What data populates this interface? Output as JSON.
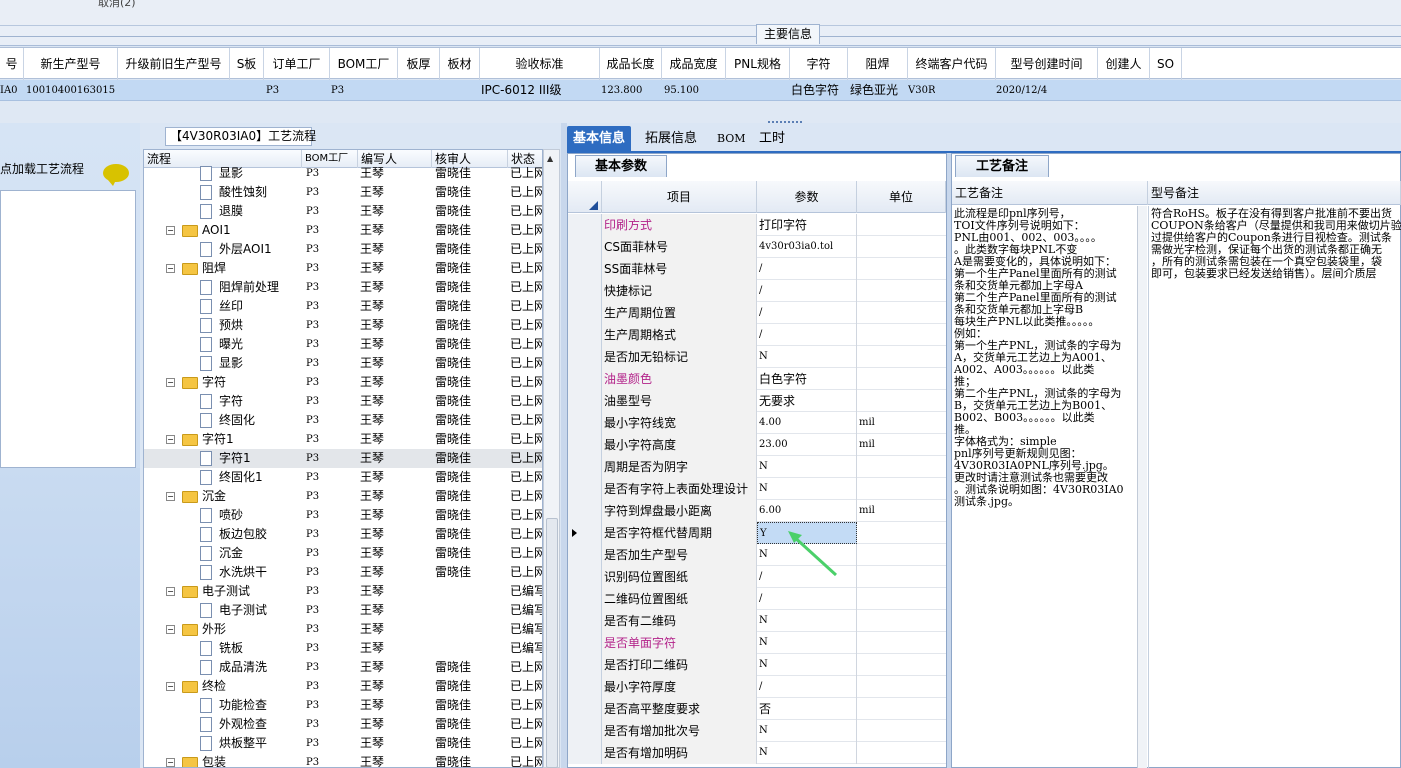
{
  "top": {
    "cancel_text": "取消(2)"
  },
  "main_info": {
    "title": "主要信息",
    "columns": [
      "号",
      "新生产型号",
      "升级前旧生产型号",
      "S板",
      "订单工厂",
      "BOM工厂",
      "板厚",
      "板材",
      "验收标准",
      "成品长度",
      "成品宽度",
      "PNL规格",
      "字符",
      "阻焊",
      "终端客户代码",
      "型号创建时间",
      "创建人",
      "SO"
    ],
    "row": {
      "c0": "IA0",
      "c1": "10010400163015",
      "c4": "P3",
      "c5": "P3",
      "c8": "IPC-6012 III级",
      "c9": "123.800",
      "c10": "95.100",
      "c12": "白色字符",
      "c13": "绿色亚光",
      "c14": "V30R",
      "c15": "2020/12/4"
    }
  },
  "left_panel": {
    "load_text": "点加载工艺流程"
  },
  "flow": {
    "title": "【4V30R03IA0】工艺流程",
    "headers": [
      "流程",
      "BOM工厂",
      "编写人",
      "核审人",
      "状态"
    ],
    "rows": [
      {
        "level": 2,
        "type": "doc",
        "name": "显影",
        "bom": "P3",
        "writer": "王琴",
        "reviewer": "雷晓佳",
        "status": "已上网"
      },
      {
        "level": 2,
        "type": "doc",
        "name": "酸性蚀刻",
        "bom": "P3",
        "writer": "王琴",
        "reviewer": "雷晓佳",
        "status": "已上网"
      },
      {
        "level": 2,
        "type": "doc",
        "name": "退膜",
        "bom": "P3",
        "writer": "王琴",
        "reviewer": "雷晓佳",
        "status": "已上网"
      },
      {
        "level": 1,
        "type": "folder",
        "name": "AOI1",
        "bom": "P3",
        "writer": "王琴",
        "reviewer": "雷晓佳",
        "status": "已上网"
      },
      {
        "level": 2,
        "type": "doc",
        "name": "外层AOI1",
        "bom": "P3",
        "writer": "王琴",
        "reviewer": "雷晓佳",
        "status": "已上网"
      },
      {
        "level": 1,
        "type": "folder",
        "name": "阻焊",
        "bom": "P3",
        "writer": "王琴",
        "reviewer": "雷晓佳",
        "status": "已上网"
      },
      {
        "level": 2,
        "type": "doc",
        "name": "阻焊前处理",
        "bom": "P3",
        "writer": "王琴",
        "reviewer": "雷晓佳",
        "status": "已上网"
      },
      {
        "level": 2,
        "type": "doc",
        "name": "丝印",
        "bom": "P3",
        "writer": "王琴",
        "reviewer": "雷晓佳",
        "status": "已上网"
      },
      {
        "level": 2,
        "type": "doc",
        "name": "预烘",
        "bom": "P3",
        "writer": "王琴",
        "reviewer": "雷晓佳",
        "status": "已上网"
      },
      {
        "level": 2,
        "type": "doc",
        "name": "曝光",
        "bom": "P3",
        "writer": "王琴",
        "reviewer": "雷晓佳",
        "status": "已上网"
      },
      {
        "level": 2,
        "type": "doc",
        "name": "显影",
        "bom": "P3",
        "writer": "王琴",
        "reviewer": "雷晓佳",
        "status": "已上网"
      },
      {
        "level": 1,
        "type": "folder",
        "name": "字符",
        "bom": "P3",
        "writer": "王琴",
        "reviewer": "雷晓佳",
        "status": "已上网"
      },
      {
        "level": 2,
        "type": "doc",
        "name": "字符",
        "bom": "P3",
        "writer": "王琴",
        "reviewer": "雷晓佳",
        "status": "已上网"
      },
      {
        "level": 2,
        "type": "doc",
        "name": "终固化",
        "bom": "P3",
        "writer": "王琴",
        "reviewer": "雷晓佳",
        "status": "已上网"
      },
      {
        "level": 1,
        "type": "folder",
        "name": "字符1",
        "bom": "P3",
        "writer": "王琴",
        "reviewer": "雷晓佳",
        "status": "已上网"
      },
      {
        "level": 2,
        "type": "doc",
        "name": "字符1",
        "bom": "P3",
        "writer": "王琴",
        "reviewer": "雷晓佳",
        "status": "已上网",
        "selected": true
      },
      {
        "level": 2,
        "type": "doc",
        "name": "终固化1",
        "bom": "P3",
        "writer": "王琴",
        "reviewer": "雷晓佳",
        "status": "已上网"
      },
      {
        "level": 1,
        "type": "folder",
        "name": "沉金",
        "bom": "P3",
        "writer": "王琴",
        "reviewer": "雷晓佳",
        "status": "已上网"
      },
      {
        "level": 2,
        "type": "doc",
        "name": "喷砂",
        "bom": "P3",
        "writer": "王琴",
        "reviewer": "雷晓佳",
        "status": "已上网"
      },
      {
        "level": 2,
        "type": "doc",
        "name": "板边包胶",
        "bom": "P3",
        "writer": "王琴",
        "reviewer": "雷晓佳",
        "status": "已上网"
      },
      {
        "level": 2,
        "type": "doc",
        "name": "沉金",
        "bom": "P3",
        "writer": "王琴",
        "reviewer": "雷晓佳",
        "status": "已上网"
      },
      {
        "level": 2,
        "type": "doc",
        "name": "水洗烘干",
        "bom": "P3",
        "writer": "王琴",
        "reviewer": "雷晓佳",
        "status": "已上网"
      },
      {
        "level": 1,
        "type": "folder",
        "name": "电子测试",
        "bom": "P3",
        "writer": "王琴",
        "reviewer": "",
        "status": "已编写"
      },
      {
        "level": 2,
        "type": "doc",
        "name": "电子测试",
        "bom": "P3",
        "writer": "王琴",
        "reviewer": "",
        "status": "已编写"
      },
      {
        "level": 1,
        "type": "folder",
        "name": "外形",
        "bom": "P3",
        "writer": "王琴",
        "reviewer": "",
        "status": "已编写"
      },
      {
        "level": 2,
        "type": "doc",
        "name": "铣板",
        "bom": "P3",
        "writer": "王琴",
        "reviewer": "",
        "status": "已编写"
      },
      {
        "level": 2,
        "type": "doc",
        "name": "成品清洗",
        "bom": "P3",
        "writer": "王琴",
        "reviewer": "雷晓佳",
        "status": "已上网"
      },
      {
        "level": 1,
        "type": "folder",
        "name": "终检",
        "bom": "P3",
        "writer": "王琴",
        "reviewer": "雷晓佳",
        "status": "已上网"
      },
      {
        "level": 2,
        "type": "doc",
        "name": "功能检查",
        "bom": "P3",
        "writer": "王琴",
        "reviewer": "雷晓佳",
        "status": "已上网"
      },
      {
        "level": 2,
        "type": "doc",
        "name": "外观检查",
        "bom": "P3",
        "writer": "王琴",
        "reviewer": "雷晓佳",
        "status": "已上网"
      },
      {
        "level": 2,
        "type": "doc",
        "name": "烘板整平",
        "bom": "P3",
        "writer": "王琴",
        "reviewer": "雷晓佳",
        "status": "已上网"
      },
      {
        "level": 1,
        "type": "folder",
        "name": "包装",
        "bom": "P3",
        "writer": "王琴",
        "reviewer": "雷晓佳",
        "status": "已上网"
      }
    ]
  },
  "tabs": [
    "基本信息",
    "拓展信息",
    "BOM",
    "工时"
  ],
  "basic": {
    "title": "基本参数",
    "headers": [
      "项目",
      "参数",
      "单位"
    ],
    "rows": [
      {
        "item": "印刷方式",
        "value": "打印字符",
        "unit": "",
        "pink": true
      },
      {
        "item": "CS面菲林号",
        "value": "4v30r03ia0.tol",
        "unit": ""
      },
      {
        "item": "SS面菲林号",
        "value": "/",
        "unit": ""
      },
      {
        "item": "快捷标记",
        "value": "/",
        "unit": ""
      },
      {
        "item": "生产周期位置",
        "value": "/",
        "unit": ""
      },
      {
        "item": "生产周期格式",
        "value": "/",
        "unit": ""
      },
      {
        "item": "是否加无铅标记",
        "value": "N",
        "unit": ""
      },
      {
        "item": "油墨颜色",
        "value": "白色字符",
        "unit": "",
        "pink": true
      },
      {
        "item": "油墨型号",
        "value": "无要求",
        "unit": ""
      },
      {
        "item": "最小字符线宽",
        "value": "4.00",
        "unit": "mil"
      },
      {
        "item": "最小字符高度",
        "value": "23.00",
        "unit": "mil"
      },
      {
        "item": "周期是否为阴字",
        "value": "N",
        "unit": ""
      },
      {
        "item": "是否有字符上表面处理设计",
        "value": "N",
        "unit": ""
      },
      {
        "item": "字符到焊盘最小距离",
        "value": "6.00",
        "unit": "mil"
      },
      {
        "item": "是否字符框代替周期",
        "value": "Y",
        "unit": "",
        "current": true
      },
      {
        "item": "是否加生产型号",
        "value": "N",
        "unit": ""
      },
      {
        "item": "识别码位置图纸",
        "value": "/",
        "unit": ""
      },
      {
        "item": "二维码位置图纸",
        "value": "/",
        "unit": ""
      },
      {
        "item": "是否有二维码",
        "value": "N",
        "unit": ""
      },
      {
        "item": "是否单面字符",
        "value": "N",
        "unit": "",
        "pink": true
      },
      {
        "item": "是否打印二维码",
        "value": "N",
        "unit": ""
      },
      {
        "item": "最小字符厚度",
        "value": "/",
        "unit": ""
      },
      {
        "item": "是否高平整度要求",
        "value": "否",
        "unit": ""
      },
      {
        "item": "是否有增加批次号",
        "value": "N",
        "unit": ""
      },
      {
        "item": "是否有增加明码",
        "value": "N",
        "unit": ""
      }
    ]
  },
  "notes": {
    "title": "工艺备注",
    "headers": [
      "工艺备注",
      "型号备注"
    ],
    "process_lines": [
      "此流程是印pnl序列号，",
      "TOI文件序列号说明如下：",
      "PNL由001、002、003。。。。",
      "。此类数字每块PNL不变",
      "A是需要变化的，具体说明如下：",
      "第一个生产Panel里面所有的测试",
      "条和交货单元都加上字母A",
      "第二个生产Panel里面所有的测试",
      "条和交货单元都加上字母B",
      "每块生产PNL以此类推。。。。。",
      "例如：",
      "第一个生产PNL，测试条的字母为",
      "A，交货单元工艺边上为A001、",
      "A002、A003。。。。。。以此类",
      "推；",
      "第二个生产PNL，测试条的字母为",
      "B，交货单元工艺边上为B001、",
      "B002、B003。。。。。。以此类",
      "推。",
      "字体格式为：simple",
      "pnl序列号更新规则见图：",
      "4V30R03IA0PNL序列号.jpg。",
      "更改时请注意测试条也需要更改",
      "。测试条说明如图：4V30R03IA0",
      "测试条.jpg。"
    ],
    "model_lines": [
      "符合RoHS。板子在没有得到客户批准前不要出货",
      "COUPON条给客户（尽量提供和我司用来做切片验",
      "过提供给客户的Coupon条进行目视检查。测试条",
      "需做光字检测，保证每个出货的测试条都正确无",
      "，所有的测试条需包装在一个真空包装袋里，袋",
      "即可，包装要求已经发送给销售）。层间介质层"
    ]
  }
}
